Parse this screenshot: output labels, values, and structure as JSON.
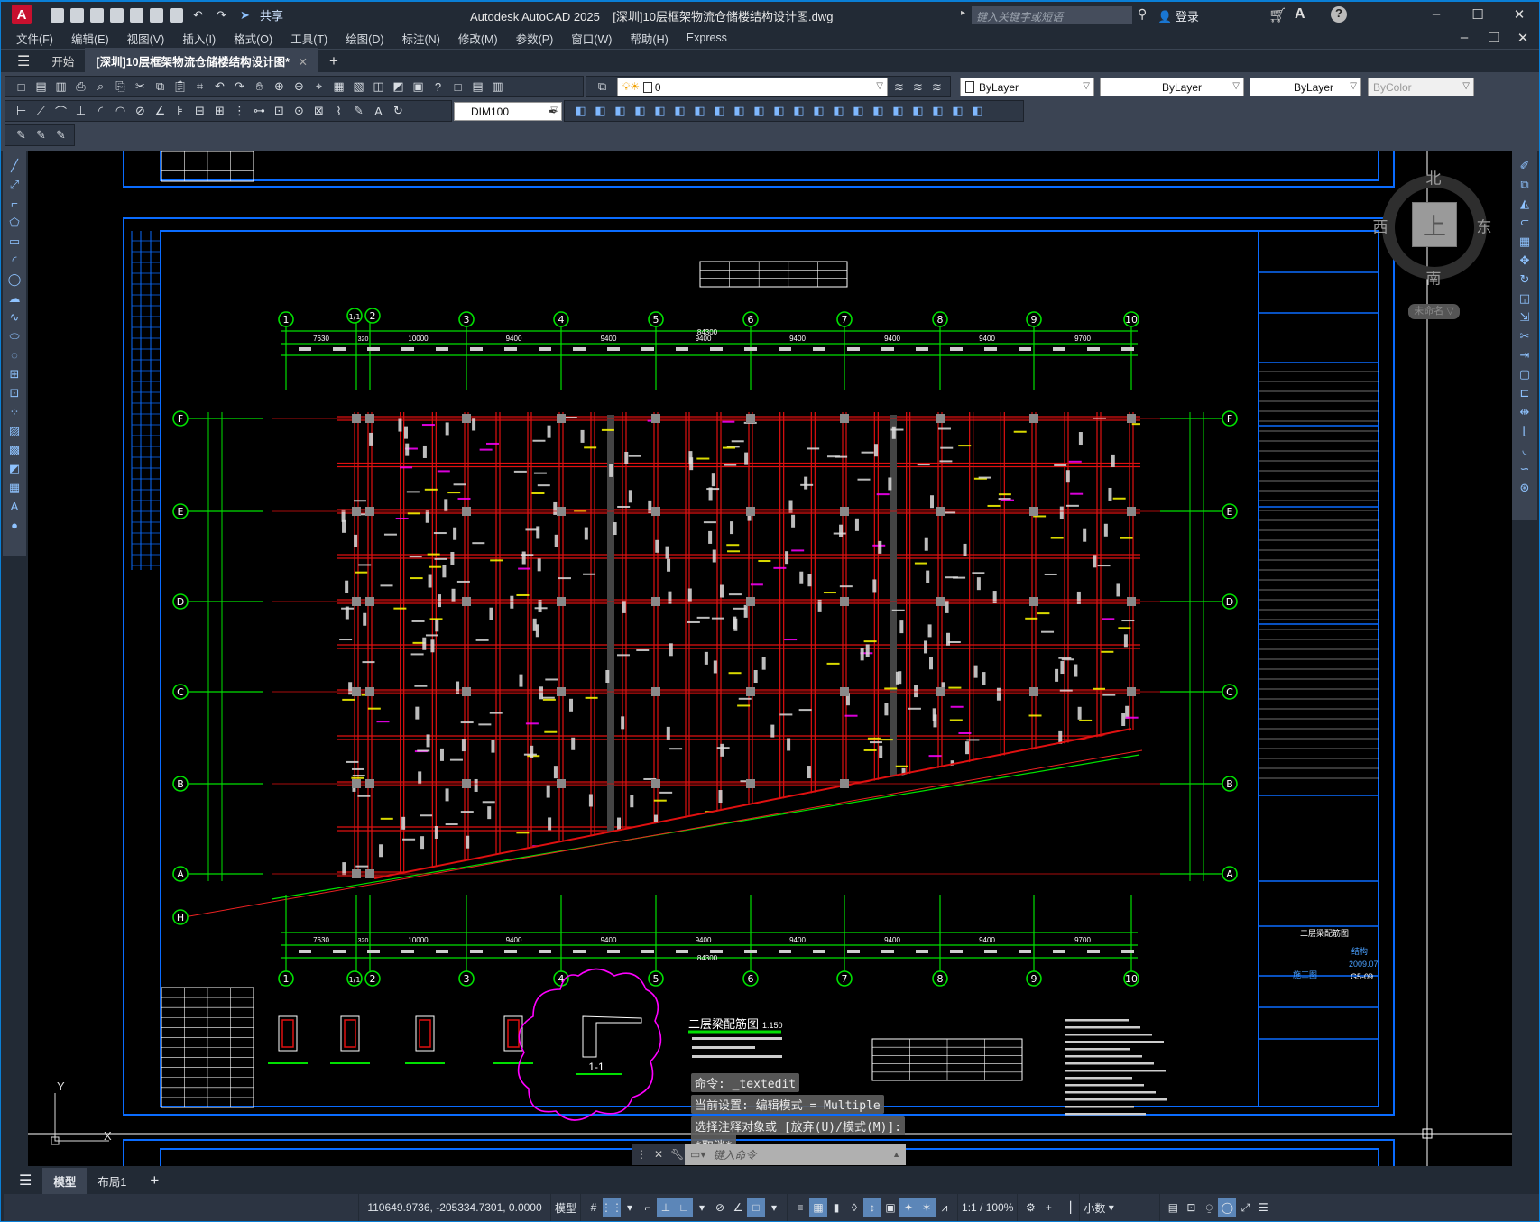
{
  "titlebar": {
    "app": "Autodesk AutoCAD 2025",
    "file": "[深圳]10层框架物流仓储楼结构设计图.dwg",
    "share": "共享",
    "search_placeholder": "键入关键字或短语",
    "login": "登录",
    "logo": "A"
  },
  "menu": [
    "文件(F)",
    "编辑(E)",
    "视图(V)",
    "插入(I)",
    "格式(O)",
    "工具(T)",
    "绘图(D)",
    "标注(N)",
    "修改(M)",
    "参数(P)",
    "窗口(W)",
    "帮助(H)",
    "Express"
  ],
  "tabs": {
    "start": "开始",
    "doc": "[深圳]10层框架物流仓储楼结构设计图*"
  },
  "toolbar": {
    "layer": "0",
    "color": "ByLayer",
    "linetype": "ByLayer",
    "lineweight": "ByLayer",
    "plotstyle": "ByColor",
    "dimstyle": "DIM100"
  },
  "viewcube": {
    "north": "北",
    "south": "南",
    "east": "东",
    "west": "西",
    "top": "上",
    "ucs": "未命名"
  },
  "drawing": {
    "axes_x": [
      "1",
      "1/1",
      "2",
      "3",
      "4",
      "5",
      "6",
      "7",
      "8",
      "9",
      "10"
    ],
    "axes_y": [
      "F",
      "E",
      "D",
      "C",
      "B",
      "A"
    ],
    "axis_h": "H",
    "total_dim": "84300",
    "span_dims": [
      "7630",
      "320",
      "10000",
      "9400",
      "9400",
      "9400",
      "9400",
      "9400",
      "9400",
      "9700"
    ],
    "plan_title": "二层梁配筋图",
    "plan_scale": "1:150",
    "section_label": "1-1",
    "titleblock": {
      "drawing_name": "二层梁配筋图",
      "discipline": "结构",
      "date": "2009.07",
      "drawing_no": "G5-09",
      "stage": "施工图"
    }
  },
  "command": {
    "history": [
      "命令: _textedit",
      "当前设置: 编辑模式 = Multiple",
      "选择注释对象或 [放弃(U)/模式(M)]:",
      "*取消*"
    ],
    "placeholder": "键入命令"
  },
  "layout_tabs": [
    "模型",
    "布局1"
  ],
  "status": {
    "coords": "110649.9736, -205334.7301, 0.0000",
    "space": "模型",
    "scale": "1:1 / 100%",
    "units": "小数"
  },
  "colors": {
    "grid": "#00e000",
    "beam": "#e01010",
    "frame": "#0a6cff",
    "column": "#8a8a8a",
    "cloud": "#ff00ff"
  }
}
